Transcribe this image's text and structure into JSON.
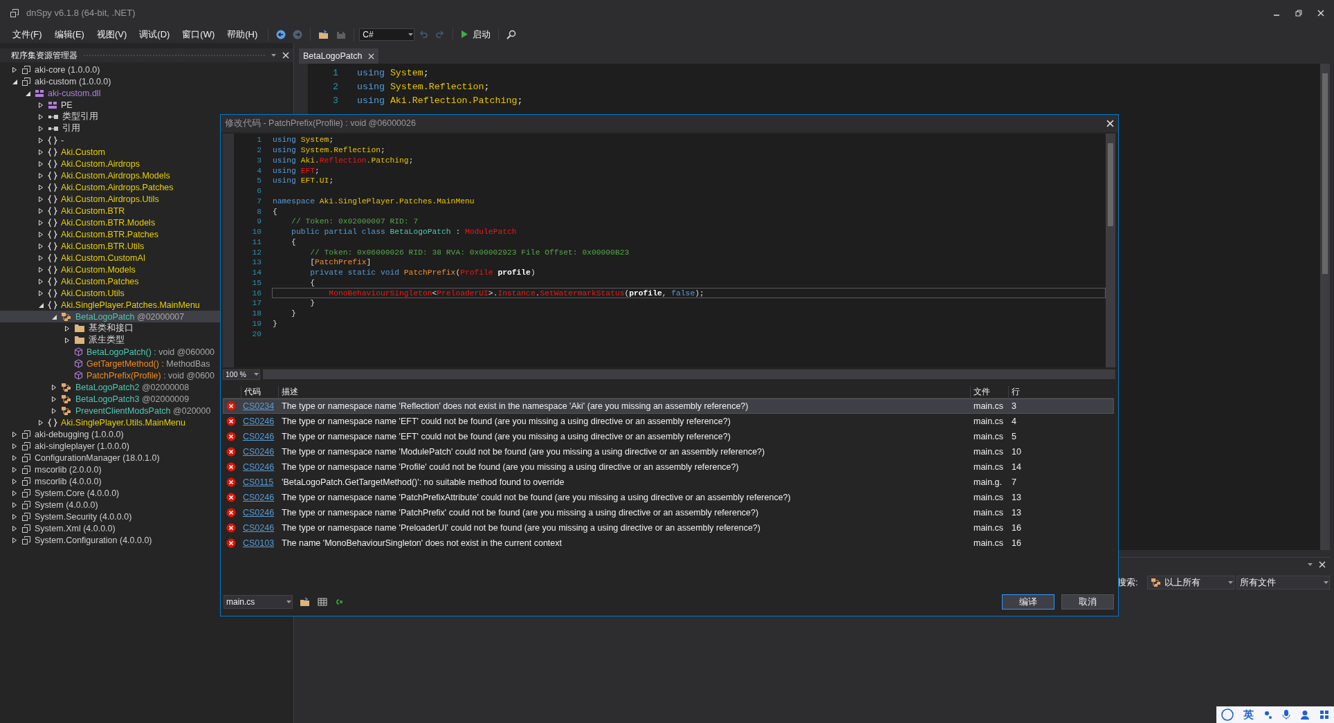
{
  "window": {
    "title": "dnSpy v6.1.8 (64-bit, .NET)"
  },
  "menu": [
    {
      "label": "文件(F)"
    },
    {
      "label": "编辑(E)"
    },
    {
      "label": "视图(V)"
    },
    {
      "label": "调试(D)"
    },
    {
      "label": "窗口(W)"
    },
    {
      "label": "帮助(H)"
    }
  ],
  "toolbar": [
    {
      "kind": "back",
      "disabled": false
    },
    {
      "kind": "forward",
      "disabled": true
    },
    {
      "kind": "open",
      "disabled": false
    },
    {
      "kind": "save",
      "disabled": true
    },
    {
      "kind": "language",
      "value": "C#"
    },
    {
      "kind": "undo",
      "disabled": true
    },
    {
      "kind": "redo",
      "disabled": true
    },
    {
      "kind": "run",
      "label": "启动",
      "disabled": false
    },
    {
      "kind": "search",
      "disabled": false
    }
  ],
  "explorer": {
    "title": "程序集资源管理器",
    "tree": [
      {
        "label": "aki-core (1.0.0.0)",
        "kind": "assembly",
        "expanded": false,
        "selected": false
      },
      {
        "label": "aki-custom (1.0.0.0)",
        "kind": "assembly",
        "expanded": true,
        "selected": false,
        "children": [
          {
            "label": "aki-custom.dll",
            "kind": "module",
            "expanded": true,
            "selected": false,
            "children": [
              {
                "label": "PE",
                "kind": "pe",
                "expanded": false,
                "selected": false
              },
              {
                "label": "类型引用",
                "kind": "ref",
                "expanded": false,
                "selected": false
              },
              {
                "label": "引用",
                "kind": "ref",
                "expanded": false,
                "selected": false
              },
              {
                "label": "-",
                "kind": "namespace_plain",
                "expanded": false,
                "selected": false
              },
              {
                "label": "Aki.Custom",
                "kind": "namespace",
                "expanded": false,
                "selected": false
              },
              {
                "label": "Aki.Custom.Airdrops",
                "kind": "namespace",
                "expanded": false,
                "selected": false
              },
              {
                "label": "Aki.Custom.Airdrops.Models",
                "kind": "namespace",
                "expanded": false,
                "selected": false
              },
              {
                "label": "Aki.Custom.Airdrops.Patches",
                "kind": "namespace",
                "expanded": false,
                "selected": false
              },
              {
                "label": "Aki.Custom.Airdrops.Utils",
                "kind": "namespace",
                "expanded": false,
                "selected": false
              },
              {
                "label": "Aki.Custom.BTR",
                "kind": "namespace",
                "expanded": false,
                "selected": false
              },
              {
                "label": "Aki.Custom.BTR.Models",
                "kind": "namespace",
                "expanded": false,
                "selected": false
              },
              {
                "label": "Aki.Custom.BTR.Patches",
                "kind": "namespace",
                "expanded": false,
                "selected": false
              },
              {
                "label": "Aki.Custom.BTR.Utils",
                "kind": "namespace",
                "expanded": false,
                "selected": false
              },
              {
                "label": "Aki.Custom.CustomAI",
                "kind": "namespace",
                "expanded": false,
                "selected": false
              },
              {
                "label": "Aki.Custom.Models",
                "kind": "namespace",
                "expanded": false,
                "selected": false
              },
              {
                "label": "Aki.Custom.Patches",
                "kind": "namespace",
                "expanded": false,
                "selected": false
              },
              {
                "label": "Aki.Custom.Utils",
                "kind": "namespace",
                "expanded": false,
                "selected": false
              },
              {
                "label": "Aki.SinglePlayer.Patches.MainMenu",
                "kind": "namespace",
                "expanded": true,
                "selected": false,
                "children": [
                  {
                    "label": "BetaLogoPatch",
                    "detail": " @02000007",
                    "kind": "class",
                    "expanded": true,
                    "selected": true,
                    "children": [
                      {
                        "label": "基类和接口",
                        "kind": "folder",
                        "expanded": false,
                        "selected": false
                      },
                      {
                        "label": "派生类型",
                        "kind": "folder",
                        "expanded": false,
                        "selected": false
                      },
                      {
                        "label": "BetaLogoPatch()",
                        "detail": " : void @060000",
                        "kind": "ctor",
                        "selected": false
                      },
                      {
                        "label": "GetTargetMethod()",
                        "detail": " : MethodBas",
                        "kind": "method",
                        "selected": false
                      },
                      {
                        "label": "PatchPrefix(Profile)",
                        "detail": " : void @0600",
                        "kind": "method",
                        "selected": false
                      }
                    ]
                  },
                  {
                    "label": "BetaLogoPatch2",
                    "detail": " @02000008",
                    "kind": "class",
                    "expanded": false,
                    "selected": false
                  },
                  {
                    "label": "BetaLogoPatch3",
                    "detail": " @02000009",
                    "kind": "class",
                    "expanded": false,
                    "selected": false
                  },
                  {
                    "label": "PreventClientModsPatch",
                    "detail": " @020000",
                    "kind": "class",
                    "expanded": false,
                    "selected": false
                  }
                ]
              },
              {
                "label": "Aki.SinglePlayer.Utils.MainMenu",
                "kind": "namespace",
                "expanded": false,
                "selected": false
              }
            ]
          }
        ]
      },
      {
        "label": "aki-debugging (1.0.0.0)",
        "kind": "assembly",
        "expanded": false,
        "selected": false
      },
      {
        "label": "aki-singleplayer (1.0.0.0)",
        "kind": "assembly",
        "expanded": false,
        "selected": false
      },
      {
        "label": "ConfigurationManager (18.0.1.0)",
        "kind": "assembly",
        "expanded": false,
        "selected": false
      },
      {
        "label": "mscorlib (2.0.0.0)",
        "kind": "assembly",
        "expanded": false,
        "selected": false
      },
      {
        "label": "mscorlib (4.0.0.0)",
        "kind": "assembly",
        "expanded": false,
        "selected": false
      },
      {
        "label": "System.Core (4.0.0.0)",
        "kind": "assembly",
        "expanded": false,
        "selected": false
      },
      {
        "label": "System (4.0.0.0)",
        "kind": "assembly",
        "expanded": false,
        "selected": false
      },
      {
        "label": "System.Security (4.0.0.0)",
        "kind": "assembly",
        "expanded": false,
        "selected": false
      },
      {
        "label": "System.Xml (4.0.0.0)",
        "kind": "assembly",
        "expanded": false,
        "selected": false
      },
      {
        "label": "System.Configuration (4.0.0.0)",
        "kind": "assembly",
        "expanded": false,
        "selected": false
      }
    ]
  },
  "editor": {
    "tabs": [
      {
        "label": "BetaLogoPatch",
        "selected": true
      }
    ],
    "lines": [
      {
        "number": "1",
        "tokens": [
          {
            "text": "using ",
            "kind": "keyword"
          },
          {
            "text": "System",
            "kind": "namespace"
          },
          {
            "text": ";",
            "kind": "plain"
          }
        ]
      },
      {
        "number": "2",
        "tokens": [
          {
            "text": "using ",
            "kind": "keyword"
          },
          {
            "text": "System.Reflection",
            "kind": "namespace"
          },
          {
            "text": ";",
            "kind": "plain"
          }
        ]
      },
      {
        "number": "3",
        "tokens": [
          {
            "text": "using ",
            "kind": "keyword"
          },
          {
            "text": "Aki.Reflection.Patching",
            "kind": "namespace"
          },
          {
            "text": ";",
            "kind": "plain"
          }
        ]
      }
    ]
  },
  "dialog": {
    "title": "修改代码 - PatchPrefix(Profile) : void @06000026",
    "code_lines": [
      {
        "number": "1",
        "current": false,
        "tokens": [
          {
            "text": "using ",
            "kind": "keyword"
          },
          {
            "text": "System",
            "kind": "namespace"
          },
          {
            "text": ";",
            "kind": "plain"
          }
        ]
      },
      {
        "number": "2",
        "current": false,
        "tokens": [
          {
            "text": "using ",
            "kind": "keyword"
          },
          {
            "text": "System.Reflection",
            "kind": "namespace"
          },
          {
            "text": ";",
            "kind": "plain"
          }
        ]
      },
      {
        "number": "3",
        "current": false,
        "tokens": [
          {
            "text": "using ",
            "kind": "keyword"
          },
          {
            "text": "Aki.",
            "kind": "namespace"
          },
          {
            "text": "Reflection",
            "kind": "error"
          },
          {
            "text": ".Patching",
            "kind": "namespace"
          },
          {
            "text": ";",
            "kind": "plain"
          }
        ]
      },
      {
        "number": "4",
        "current": false,
        "tokens": [
          {
            "text": "using ",
            "kind": "keyword"
          },
          {
            "text": "EFT",
            "kind": "error"
          },
          {
            "text": ";",
            "kind": "plain"
          }
        ]
      },
      {
        "number": "5",
        "current": false,
        "tokens": [
          {
            "text": "using ",
            "kind": "keyword"
          },
          {
            "text": "EFT.UI",
            "kind": "namespace"
          },
          {
            "text": ";",
            "kind": "plain"
          }
        ]
      },
      {
        "number": "6",
        "current": false
      },
      {
        "number": "7",
        "current": false,
        "tokens": [
          {
            "text": "namespace ",
            "kind": "keyword"
          },
          {
            "text": "Aki.SinglePlayer.Patches.MainMenu",
            "kind": "namespace"
          }
        ]
      },
      {
        "number": "8",
        "current": false,
        "tokens": [
          {
            "text": "{",
            "kind": "plain"
          }
        ]
      },
      {
        "number": "9",
        "current": false,
        "tokens": [
          {
            "text": "    // Token: 0x02000007 RID: 7",
            "kind": "comment"
          }
        ]
      },
      {
        "number": "10",
        "current": false,
        "tokens": [
          {
            "text": "    public partial class ",
            "kind": "keyword"
          },
          {
            "text": "BetaLogoPatch",
            "kind": "class"
          },
          {
            "text": " : ",
            "kind": "plain"
          },
          {
            "text": "ModulePatch",
            "kind": "error"
          }
        ]
      },
      {
        "number": "11",
        "current": false,
        "tokens": [
          {
            "text": "    {",
            "kind": "plain"
          }
        ]
      },
      {
        "number": "12",
        "current": false,
        "tokens": [
          {
            "text": "        // Token: 0x06000026 RID: 38 RVA: 0x00002923 File Offset: 0x00000B23",
            "kind": "comment"
          }
        ]
      },
      {
        "number": "13",
        "current": false,
        "tokens": [
          {
            "text": "        [",
            "kind": "plain"
          },
          {
            "text": "PatchPrefix",
            "kind": "method"
          },
          {
            "text": "]",
            "kind": "plain"
          }
        ]
      },
      {
        "number": "14",
        "current": false,
        "tokens": [
          {
            "text": "        private static void ",
            "kind": "keyword"
          },
          {
            "text": "PatchPrefix",
            "kind": "method"
          },
          {
            "text": "(",
            "kind": "plain"
          },
          {
            "text": "Profile",
            "kind": "error"
          },
          {
            "text": " profile",
            "kind": "param"
          },
          {
            "text": ")",
            "kind": "plain"
          }
        ]
      },
      {
        "number": "15",
        "current": false,
        "tokens": [
          {
            "text": "        {",
            "kind": "plain"
          }
        ]
      },
      {
        "number": "16",
        "current": true,
        "tokens": [
          {
            "text": "            MonoBehaviourSingleton",
            "kind": "error"
          },
          {
            "text": "<",
            "kind": "plain"
          },
          {
            "text": "PreloaderUI",
            "kind": "error"
          },
          {
            "text": ">.",
            "kind": "plain"
          },
          {
            "text": "Instance",
            "kind": "error"
          },
          {
            "text": ".",
            "kind": "plain"
          },
          {
            "text": "SetWatermarkStatus",
            "kind": "error"
          },
          {
            "text": "(",
            "kind": "plain"
          },
          {
            "text": "profile",
            "kind": "param"
          },
          {
            "text": ", ",
            "kind": "plain"
          },
          {
            "text": "false",
            "kind": "keyword"
          },
          {
            "text": ");",
            "kind": "plain"
          }
        ]
      },
      {
        "number": "17",
        "current": false,
        "tokens": [
          {
            "text": "        }",
            "kind": "plain"
          }
        ]
      },
      {
        "number": "18",
        "current": false,
        "tokens": [
          {
            "text": "    }",
            "kind": "plain"
          }
        ]
      },
      {
        "number": "19",
        "current": false,
        "tokens": [
          {
            "text": "}",
            "kind": "plain"
          }
        ]
      },
      {
        "number": "20",
        "current": false
      }
    ],
    "zoom": "100 %",
    "error_columns": [
      "代码",
      "描述",
      "文件",
      "行"
    ],
    "errors": [
      {
        "code": "CS0234",
        "description": "The type or namespace name 'Reflection' does not exist in the namespace 'Aki' (are you missing an assembly reference?)",
        "file": "main.cs",
        "line": "3",
        "selected": true
      },
      {
        "code": "CS0246",
        "description": "The type or namespace name 'EFT' could not be found (are you missing a using directive or an assembly reference?)",
        "file": "main.cs",
        "line": "4",
        "selected": false
      },
      {
        "code": "CS0246",
        "description": "The type or namespace name 'EFT' could not be found (are you missing a using directive or an assembly reference?)",
        "file": "main.cs",
        "line": "5",
        "selected": false
      },
      {
        "code": "CS0246",
        "description": "The type or namespace name 'ModulePatch' could not be found (are you missing a using directive or an assembly reference?)",
        "file": "main.cs",
        "line": "10",
        "selected": false
      },
      {
        "code": "CS0246",
        "description": "The type or namespace name 'Profile' could not be found (are you missing a using directive or an assembly reference?)",
        "file": "main.cs",
        "line": "14",
        "selected": false
      },
      {
        "code": "CS0115",
        "description": "'BetaLogoPatch.GetTargetMethod()': no suitable method found to override",
        "file": "main.g.",
        "line": "7",
        "selected": false
      },
      {
        "code": "CS0246",
        "description": "The type or namespace name 'PatchPrefixAttribute' could not be found (are you missing a using directive or an assembly reference?)",
        "file": "main.cs",
        "line": "13",
        "selected": false
      },
      {
        "code": "CS0246",
        "description": "The type or namespace name 'PatchPrefix' could not be found (are you missing a using directive or an assembly reference?)",
        "file": "main.cs",
        "line": "13",
        "selected": false
      },
      {
        "code": "CS0246",
        "description": "The type or namespace name 'PreloaderUI' could not be found (are you missing a using directive or an assembly reference?)",
        "file": "main.cs",
        "line": "16",
        "selected": false
      },
      {
        "code": "CS0103",
        "description": "The name 'MonoBehaviourSingleton' does not exist in the current context",
        "file": "main.cs",
        "line": "16",
        "selected": false
      }
    ],
    "file": "main.cs",
    "buttons": [
      {
        "label": "编译",
        "kind": "primary"
      },
      {
        "label": "取消",
        "kind": "normal"
      }
    ]
  },
  "search_panel": {
    "label": "搜索:",
    "scope": "以上所有",
    "files": "所有文件"
  },
  "ime_bar": {
    "label": "英"
  }
}
